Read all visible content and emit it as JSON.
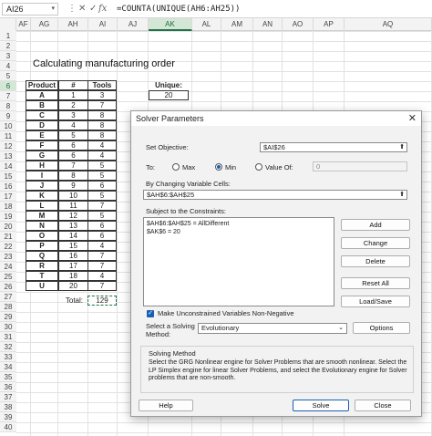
{
  "formula_bar": {
    "name_box": "AI26",
    "cancel_icon": "✕",
    "enter_icon": "✓",
    "fx_label": "fx",
    "formula": "=COUNTA(UNIQUE(AH6:AH25))"
  },
  "columns": [
    "AF",
    "AG",
    "AH",
    "AI",
    "AJ",
    "AK",
    "AL",
    "AM",
    "AN",
    "AO",
    "AP",
    "AQ"
  ],
  "selected_column": "AK",
  "rows": [
    "1",
    "2",
    "3",
    "4",
    "5",
    "6",
    "7",
    "8",
    "9",
    "10",
    "11",
    "12",
    "13",
    "14",
    "15",
    "16",
    "17",
    "18",
    "19",
    "20",
    "21",
    "22",
    "23",
    "24",
    "25",
    "26",
    "27",
    "28",
    "29",
    "30",
    "31",
    "32",
    "33",
    "34",
    "35",
    "36",
    "37",
    "38",
    "39",
    "40"
  ],
  "sheet": {
    "title": "Calculating manufacturing order",
    "headers": [
      "Product",
      "#",
      "Tools"
    ],
    "table": [
      [
        "A",
        "1",
        "3"
      ],
      [
        "B",
        "2",
        "7"
      ],
      [
        "C",
        "3",
        "8"
      ],
      [
        "D",
        "4",
        "8"
      ],
      [
        "E",
        "5",
        "8"
      ],
      [
        "F",
        "6",
        "4"
      ],
      [
        "G",
        "6",
        "4"
      ],
      [
        "H",
        "7",
        "5"
      ],
      [
        "I",
        "8",
        "5"
      ],
      [
        "J",
        "9",
        "6"
      ],
      [
        "K",
        "10",
        "5"
      ],
      [
        "L",
        "11",
        "7"
      ],
      [
        "M",
        "12",
        "5"
      ],
      [
        "N",
        "13",
        "6"
      ],
      [
        "O",
        "14",
        "6"
      ],
      [
        "P",
        "15",
        "4"
      ],
      [
        "Q",
        "16",
        "7"
      ],
      [
        "R",
        "17",
        "7"
      ],
      [
        "T",
        "18",
        "4"
      ],
      [
        "U",
        "20",
        "7"
      ]
    ],
    "total_label": "Total:",
    "total_value": "129",
    "unique_label": "Unique:",
    "unique_value": "20"
  },
  "solver": {
    "title": "Solver Parameters",
    "close_icon": "✕",
    "set_objective_label": "Set Objective:",
    "objective_value": "$AI$26",
    "to_label": "To:",
    "max_label": "Max",
    "min_label": "Min",
    "value_of_label": "Value Of:",
    "value_of_value": "0",
    "selected_goal": "Min",
    "changing_label": "By Changing Variable Cells:",
    "changing_value": "$AH$6:$AH$25",
    "constraints_label": "Subject to the Constraints:",
    "constraints": [
      "$AH$6:$AH$25 = AllDifferent",
      "$AK$6 = 20"
    ],
    "buttons": {
      "add": "Add",
      "change": "Change",
      "delete": "Delete",
      "reset_all": "Reset All",
      "load_save": "Load/Save",
      "options": "Options",
      "help": "Help",
      "solve": "Solve",
      "close": "Close"
    },
    "unconstrained_label": "Make Unconstrained Variables Non-Negative",
    "unconstrained_checked": true,
    "method_label_1": "Select a Solving",
    "method_label_2": "Method:",
    "method_value": "Evolutionary",
    "solving_method_title": "Solving Method",
    "solving_method_text": "Select the GRG Nonlinear engine for Solver Problems that are smooth nonlinear. Select the LP Simplex engine for linear Solver Problems, and select the Evolutionary engine for Solver problems that are non-smooth."
  }
}
